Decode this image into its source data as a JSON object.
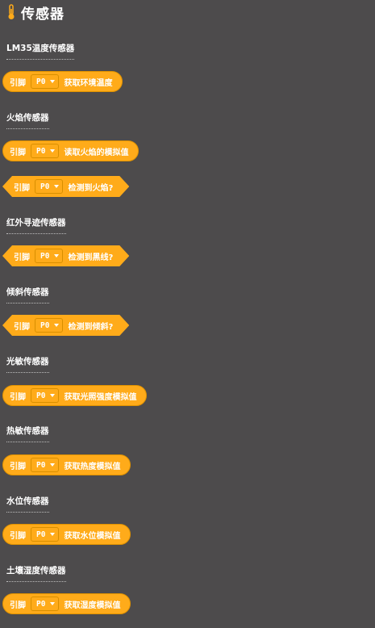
{
  "header": {
    "title": "传感器",
    "icon": "thermometer-icon"
  },
  "colors": {
    "background": "#4d4b4c",
    "block": "#ffab1a",
    "block_border": "#e09200"
  },
  "sections": [
    {
      "label": "LM35温度传感器",
      "blocks": [
        {
          "type": "reporter",
          "pin_label": "引脚",
          "pin_value": "P0",
          "text": "获取环境温度"
        }
      ]
    },
    {
      "label": "火焰传感器",
      "blocks": [
        {
          "type": "reporter",
          "pin_label": "引脚",
          "pin_value": "P0",
          "text": "读取火焰的模拟值"
        },
        {
          "type": "boolean",
          "pin_label": "引脚",
          "pin_value": "P0",
          "text": "检测到火焰?"
        }
      ]
    },
    {
      "label": "红外寻迹传感器",
      "blocks": [
        {
          "type": "boolean",
          "pin_label": "引脚",
          "pin_value": "P0",
          "text": "检测到黑线?"
        }
      ]
    },
    {
      "label": "倾斜传感器",
      "blocks": [
        {
          "type": "boolean",
          "pin_label": "引脚",
          "pin_value": "P0",
          "text": "检测到倾斜?"
        }
      ]
    },
    {
      "label": "光敏传感器",
      "blocks": [
        {
          "type": "reporter",
          "pin_label": "引脚",
          "pin_value": "P0",
          "text": "获取光照强度模拟值"
        }
      ]
    },
    {
      "label": "热敏传感器",
      "blocks": [
        {
          "type": "reporter",
          "pin_label": "引脚",
          "pin_value": "P0",
          "text": "获取热度模拟值"
        }
      ]
    },
    {
      "label": "水位传感器",
      "blocks": [
        {
          "type": "reporter",
          "pin_label": "引脚",
          "pin_value": "P0",
          "text": "获取水位模拟值"
        }
      ]
    },
    {
      "label": "土壤湿度传感器",
      "blocks": [
        {
          "type": "reporter",
          "pin_label": "引脚",
          "pin_value": "P0",
          "text": "获取湿度模拟值"
        }
      ]
    }
  ]
}
